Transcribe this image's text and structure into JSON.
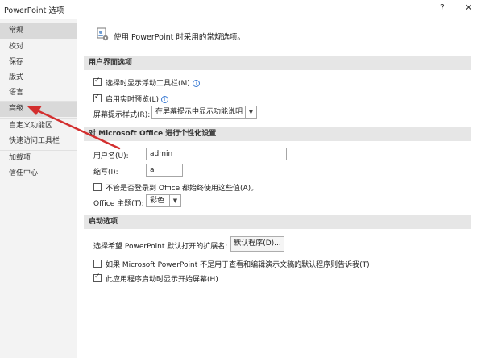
{
  "window": {
    "title": "PowerPoint 选项",
    "help_label": "?",
    "close_label": "✕"
  },
  "sidebar": {
    "items": [
      {
        "label": "常规",
        "selected": true
      },
      {
        "label": "校对"
      },
      {
        "label": "保存"
      },
      {
        "label": "版式"
      },
      {
        "label": "语言"
      },
      {
        "label": "高级",
        "highlighted": true
      },
      {
        "label": "自定义功能区"
      },
      {
        "label": "快速访问工具栏"
      },
      {
        "label": "加载项"
      },
      {
        "label": "信任中心"
      }
    ]
  },
  "main": {
    "header": {
      "icon": "settings-users-icon",
      "text": "使用 PowerPoint 时采用的常规选项。"
    },
    "ui_section": {
      "title": "用户界面选项",
      "show_mini_toolbar": {
        "label": "选择时显示浮动工具栏(M)",
        "checked": true
      },
      "live_preview": {
        "label": "启用实时预览(L)",
        "checked": true
      },
      "tooltip_style": {
        "label": "屏幕提示样式(R):",
        "value": "在屏幕提示中显示功能说明"
      }
    },
    "personalize_section": {
      "title": "对 Microsoft Office 进行个性化设置",
      "username": {
        "label": "用户名(U):",
        "value": "admin"
      },
      "initials": {
        "label": "缩写(I):",
        "value": "a"
      },
      "always_use": {
        "label": "不管是否登录到 Office 都始终使用这些值(A)。",
        "checked": false
      },
      "theme": {
        "label": "Office 主题(T):",
        "value": "彩色"
      }
    },
    "startup_section": {
      "title": "启动选项",
      "default_ext": {
        "label": "选择希望 PowerPoint 默认打开的扩展名:",
        "button": "默认程序(D)..."
      },
      "tell_me": {
        "label": "如果 Microsoft PowerPoint 不是用于查看和编辑演示文稿的默认程序则告诉我(T)",
        "checked": false
      },
      "show_start": {
        "label": "此应用程序启动时显示开始屏幕(H)",
        "checked": true
      }
    }
  },
  "colors": {
    "accent_arrow": "#d32f2f",
    "sidebar_bg": "#f3f3f3",
    "section_bg": "#e6e6e6"
  }
}
